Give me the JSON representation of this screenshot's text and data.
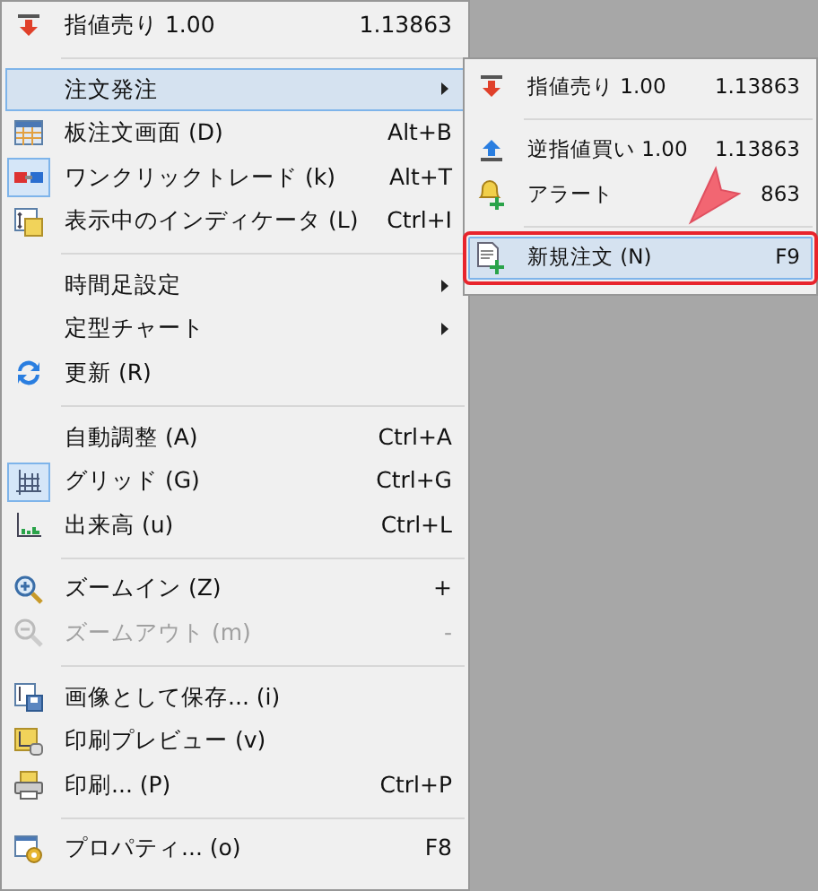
{
  "menu": {
    "items": [
      {
        "kind": "item",
        "label": "指値売り 1.00",
        "shortcut": "1.13863",
        "checked": false,
        "disabled": false,
        "selected": false,
        "submenu": false
      },
      {
        "kind": "separator"
      },
      {
        "kind": "item",
        "label": "注文発注",
        "checked": false,
        "disabled": false,
        "selected": true,
        "submenu": true
      },
      {
        "kind": "item",
        "label": "板注文画面 (D)",
        "shortcut": "Alt+B",
        "checked": false,
        "disabled": false,
        "selected": false,
        "submenu": false
      },
      {
        "kind": "item",
        "label": "ワンクリックトレード (k)",
        "shortcut": "Alt+T",
        "checked": true,
        "disabled": false,
        "selected": false,
        "submenu": false
      },
      {
        "kind": "item",
        "label": "表示中のインディケータ (L)",
        "shortcut": "Ctrl+I",
        "checked": false,
        "disabled": false,
        "selected": false,
        "submenu": false
      },
      {
        "kind": "separator"
      },
      {
        "kind": "item",
        "label": "時間足設定",
        "checked": false,
        "disabled": false,
        "selected": false,
        "submenu": true
      },
      {
        "kind": "item",
        "label": "定型チャート",
        "checked": false,
        "disabled": false,
        "selected": false,
        "submenu": true
      },
      {
        "kind": "item",
        "label": "更新 (R)",
        "checked": false,
        "disabled": false,
        "selected": false,
        "submenu": false
      },
      {
        "kind": "separator"
      },
      {
        "kind": "item",
        "label": "自動調整 (A)",
        "shortcut": "Ctrl+A",
        "checked": false,
        "disabled": false,
        "selected": false,
        "submenu": false
      },
      {
        "kind": "item",
        "label": "グリッド (G)",
        "shortcut": "Ctrl+G",
        "checked": true,
        "disabled": false,
        "selected": false,
        "submenu": false
      },
      {
        "kind": "item",
        "label": "出来高 (u)",
        "shortcut": "Ctrl+L",
        "checked": false,
        "disabled": false,
        "selected": false,
        "submenu": false
      },
      {
        "kind": "separator"
      },
      {
        "kind": "item",
        "label": "ズームイン (Z)",
        "shortcut": "+",
        "checked": false,
        "disabled": false,
        "selected": false,
        "submenu": false
      },
      {
        "kind": "item",
        "label": "ズームアウト (m)",
        "shortcut": "-",
        "checked": false,
        "disabled": true,
        "selected": false,
        "submenu": false
      },
      {
        "kind": "separator"
      },
      {
        "kind": "item",
        "label": "画像として保存... (i)",
        "checked": false,
        "disabled": false,
        "selected": false,
        "submenu": false
      },
      {
        "kind": "item",
        "label": "印刷プレビュー (v)",
        "checked": false,
        "disabled": false,
        "selected": false,
        "submenu": false
      },
      {
        "kind": "item",
        "label": "印刷... (P)",
        "shortcut": "Ctrl+P",
        "checked": false,
        "disabled": false,
        "selected": false,
        "submenu": false
      },
      {
        "kind": "separator"
      },
      {
        "kind": "item",
        "label": "プロパティ... (o)",
        "shortcut": "F8",
        "checked": false,
        "disabled": false,
        "selected": false,
        "submenu": false
      }
    ]
  },
  "submenu": {
    "items": [
      {
        "kind": "item",
        "label": "指値売り 1.00",
        "shortcut": "1.13863",
        "selected": false
      },
      {
        "kind": "separator"
      },
      {
        "kind": "item",
        "label": "逆指値買い 1.00",
        "shortcut": "1.13863",
        "selected": false
      },
      {
        "kind": "item",
        "label": "アラート",
        "shortcut": "863",
        "selected": false
      },
      {
        "kind": "separator"
      },
      {
        "kind": "item",
        "label": "新規注文 (N)",
        "shortcut": "F9",
        "selected": true
      }
    ]
  }
}
